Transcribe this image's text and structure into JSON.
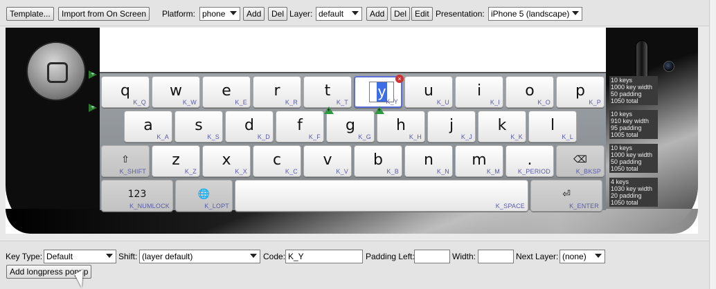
{
  "toolbar": {
    "template_btn": "Template...",
    "import_btn": "Import from On Screen",
    "platform_label": "Platform:",
    "platform_value": "phone",
    "add1": "Add",
    "del1": "Del",
    "layer_label": "Layer:",
    "layer_value": "default",
    "add2": "Add",
    "del2": "Del",
    "edit": "Edit",
    "presentation_label": "Presentation:",
    "presentation_value": "iPhone 5 (landscape)"
  },
  "keyboard": {
    "row1": [
      {
        "cap": "q",
        "code": "K_Q"
      },
      {
        "cap": "w",
        "code": "K_W"
      },
      {
        "cap": "e",
        "code": "K_E"
      },
      {
        "cap": "r",
        "code": "K_R"
      },
      {
        "cap": "t",
        "code": "K_T"
      },
      {
        "cap": "y",
        "code": "K_Y"
      },
      {
        "cap": "u",
        "code": "K_U"
      },
      {
        "cap": "i",
        "code": "K_I"
      },
      {
        "cap": "o",
        "code": "K_O"
      },
      {
        "cap": "p",
        "code": "K_P"
      }
    ],
    "row2": [
      {
        "cap": "a",
        "code": "K_A"
      },
      {
        "cap": "s",
        "code": "K_S"
      },
      {
        "cap": "d",
        "code": "K_D"
      },
      {
        "cap": "f",
        "code": "K_F"
      },
      {
        "cap": "g",
        "code": "K_G"
      },
      {
        "cap": "h",
        "code": "K_H"
      },
      {
        "cap": "j",
        "code": "K_J"
      },
      {
        "cap": "k",
        "code": "K_K"
      },
      {
        "cap": "l",
        "code": "K_L"
      }
    ],
    "row3": [
      {
        "cap": "⇧",
        "code": "K_SHIFT"
      },
      {
        "cap": "z",
        "code": "K_Z"
      },
      {
        "cap": "x",
        "code": "K_X"
      },
      {
        "cap": "c",
        "code": "K_C"
      },
      {
        "cap": "v",
        "code": "K_V"
      },
      {
        "cap": "b",
        "code": "K_B"
      },
      {
        "cap": "n",
        "code": "K_N"
      },
      {
        "cap": "m",
        "code": "K_M"
      },
      {
        "cap": ".",
        "code": "K_PERIOD"
      },
      {
        "cap": "⌫",
        "code": "K_BKSP"
      }
    ],
    "row4": [
      {
        "cap": "123",
        "code": "K_NUMLOCK"
      },
      {
        "cap": "🌐",
        "code": "K_LOPT"
      },
      {
        "cap": "",
        "code": "K_SPACE"
      },
      {
        "cap": "⏎",
        "code": "K_ENTER"
      }
    ]
  },
  "row_info": [
    [
      "10 keys",
      "1000 key width",
      "50 padding",
      "1050 total"
    ],
    [
      "10 keys",
      "910 key width",
      "95 padding",
      "1005 total"
    ],
    [
      "10 keys",
      "1000 key width",
      "50 padding",
      "1050 total"
    ],
    [
      "4 keys",
      "1030 key width",
      "20 padding",
      "1050 total"
    ]
  ],
  "props": {
    "key_type_label": "Key Type:",
    "key_type_value": "Default",
    "shift_label": "Shift:",
    "shift_value": "(layer default)",
    "code_label": "Code:",
    "code_value": "K_Y",
    "padding_left_label": "Padding Left:",
    "padding_left_value": "",
    "width_label": "Width:",
    "width_value": "",
    "next_layer_label": "Next Layer:",
    "next_layer_value": "(none)",
    "longpress_btn": "Add longpress popup"
  },
  "colors": {
    "selected_border": "#5b6fd8",
    "code_text": "#5a5aa8",
    "longpress_marker": "#2f9a3f"
  }
}
